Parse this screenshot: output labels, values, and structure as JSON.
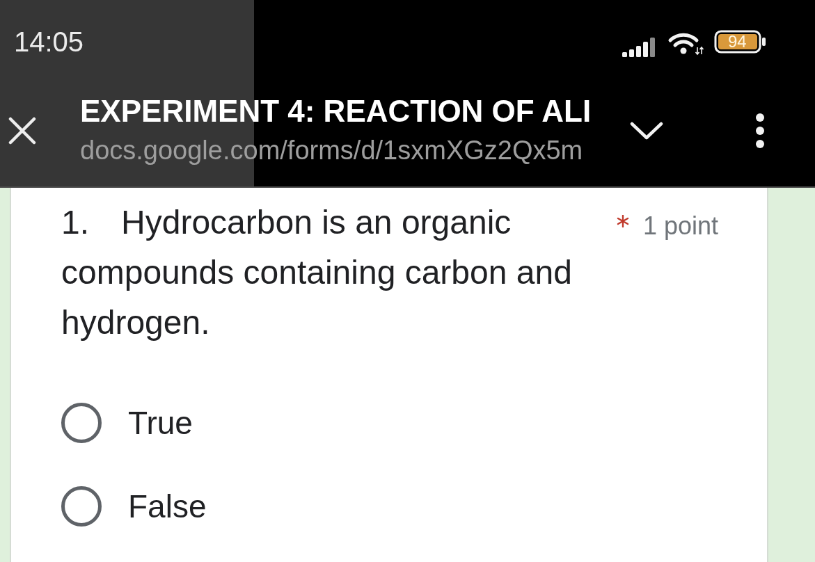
{
  "status_bar": {
    "time": "14:05",
    "battery": "94"
  },
  "header": {
    "title": "EXPERIMENT 4: REACTION OF ALI",
    "url": "docs.google.com/forms/d/1sxmXGz2Qx5m"
  },
  "question": {
    "number": "1.",
    "text": "Hydrocarbon is an organic compounds containing carbon and hydrogen.",
    "required": true,
    "points": "1 point",
    "options": [
      {
        "label": "True",
        "selected": false
      },
      {
        "label": "False",
        "selected": false
      }
    ]
  }
}
